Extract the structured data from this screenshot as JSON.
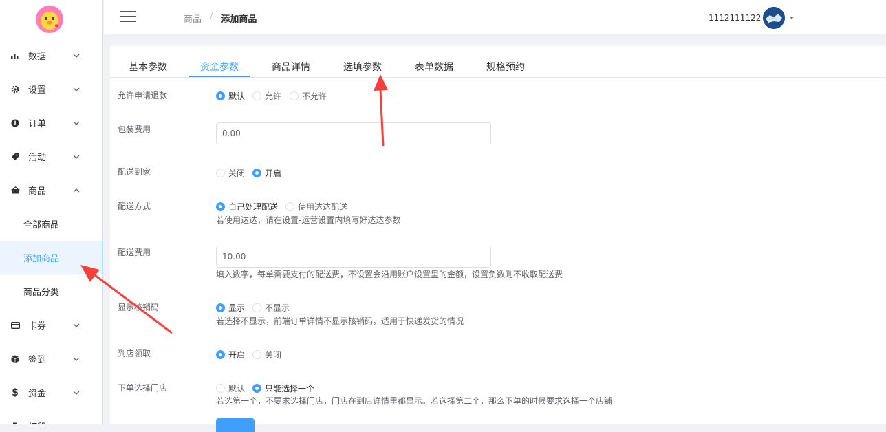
{
  "sidebar": {
    "items": [
      {
        "label": "数据",
        "icon": "bar-chart-icon"
      },
      {
        "label": "设置",
        "icon": "gear-icon"
      },
      {
        "label": "订单",
        "icon": "info-icon"
      },
      {
        "label": "活动",
        "icon": "tag-icon"
      },
      {
        "label": "商品",
        "icon": "basket-icon"
      },
      {
        "label": "卡券",
        "icon": "card-icon"
      },
      {
        "label": "签到",
        "icon": "cube-icon"
      },
      {
        "label": "资金",
        "icon": "dollar-icon"
      },
      {
        "label": "打印",
        "icon": "printer-icon"
      }
    ],
    "sub_items": [
      "全部商品",
      "添加商品",
      "商品分类"
    ]
  },
  "header": {
    "breadcrumb_root": "商品",
    "breadcrumb_sep": "/",
    "breadcrumb_current": "添加商品",
    "username": "1112111122"
  },
  "tabs": [
    "基本参数",
    "资金参数",
    "商品详情",
    "选填参数",
    "表单数据",
    "规格预约"
  ],
  "form": {
    "refund": {
      "label": "允许申请退款",
      "options": [
        "默认",
        "允许",
        "不允许"
      ]
    },
    "packing_fee": {
      "label": "包装费用",
      "value": "0.00"
    },
    "delivery_home": {
      "label": "配送到家",
      "options": [
        "关闭",
        "开启"
      ]
    },
    "delivery_method": {
      "label": "配送方式",
      "options": [
        "自己处理配送",
        "使用达达配送"
      ],
      "hint": "若使用达达，请在设置-运营设置内填写好达达参数"
    },
    "delivery_fee": {
      "label": "配送费用",
      "value": "10.00",
      "hint": "填入数字，每单需要支付的配送费，不设置会沿用账户设置里的金额，设置负数则不收取配送费"
    },
    "show_code": {
      "label": "显示核销码",
      "options": [
        "显示",
        "不显示"
      ],
      "hint": "若选择不显示，前端订单详情不显示核销码，适用于快递发货的情况"
    },
    "pickup": {
      "label": "到店领取",
      "options": [
        "开启",
        "关闭"
      ]
    },
    "store_select": {
      "label": "下单选择门店",
      "options": [
        "默认",
        "只能选择一个"
      ],
      "hint": "若选第一个，不要求选择门店，门店在到店详情里都显示。若选择第二个，那么下单的时候要求选择一个店铺"
    }
  },
  "colors": {
    "accent": "#409eff",
    "arrow": "#f5413a"
  }
}
